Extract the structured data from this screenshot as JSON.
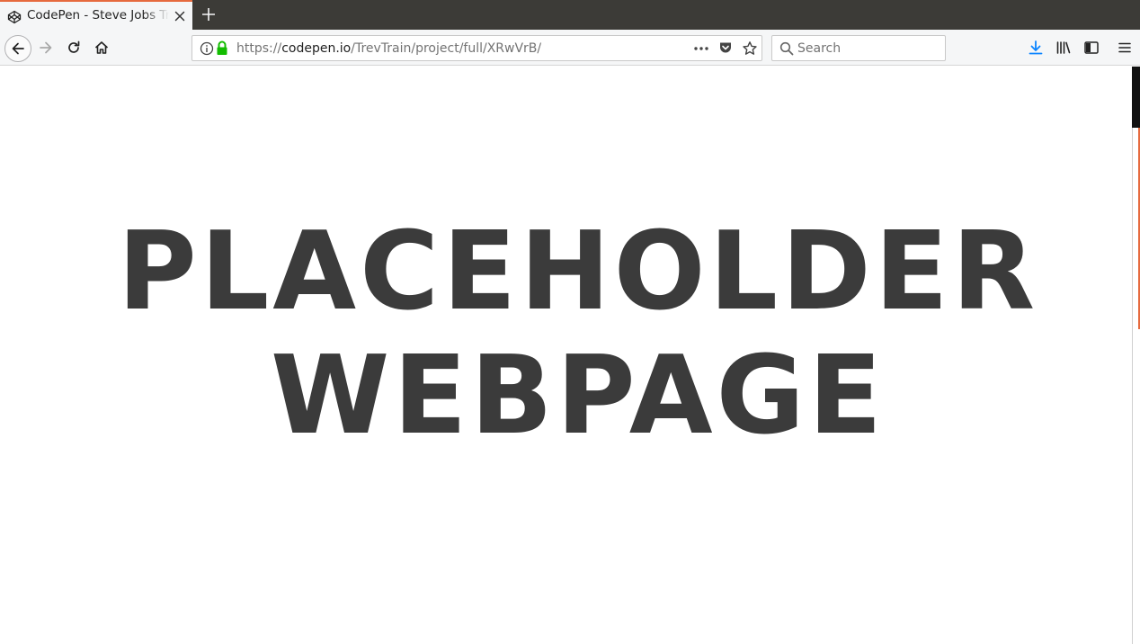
{
  "browser": {
    "tab": {
      "title": "CodePen - Steve Jobs Tribute Page",
      "favicon": "codepen-icon"
    },
    "url": {
      "scheme": "https://",
      "domain": "codepen.io",
      "path": "/TrevTrain/project/full/XRwVrB/"
    },
    "search": {
      "placeholder": "Search"
    },
    "icons": {
      "back": "back-arrow-icon",
      "forward": "forward-arrow-icon",
      "reload": "reload-icon",
      "home": "home-icon",
      "info": "info-icon",
      "lock": "lock-icon",
      "page_actions": "ellipsis-icon",
      "pocket": "pocket-icon",
      "bookmark": "star-icon",
      "downloads": "download-icon",
      "library": "library-icon",
      "sidebar": "sidebar-icon",
      "menu": "hamburger-menu-icon"
    },
    "colors": {
      "tab_accent": "#e66a3e",
      "lock_green": "#12bc00",
      "download_blue": "#0a84ff"
    }
  },
  "page": {
    "headline_line1": "PLACEHOLDER",
    "headline_line2": "WEBPAGE",
    "text_color": "#3b3b3b"
  }
}
